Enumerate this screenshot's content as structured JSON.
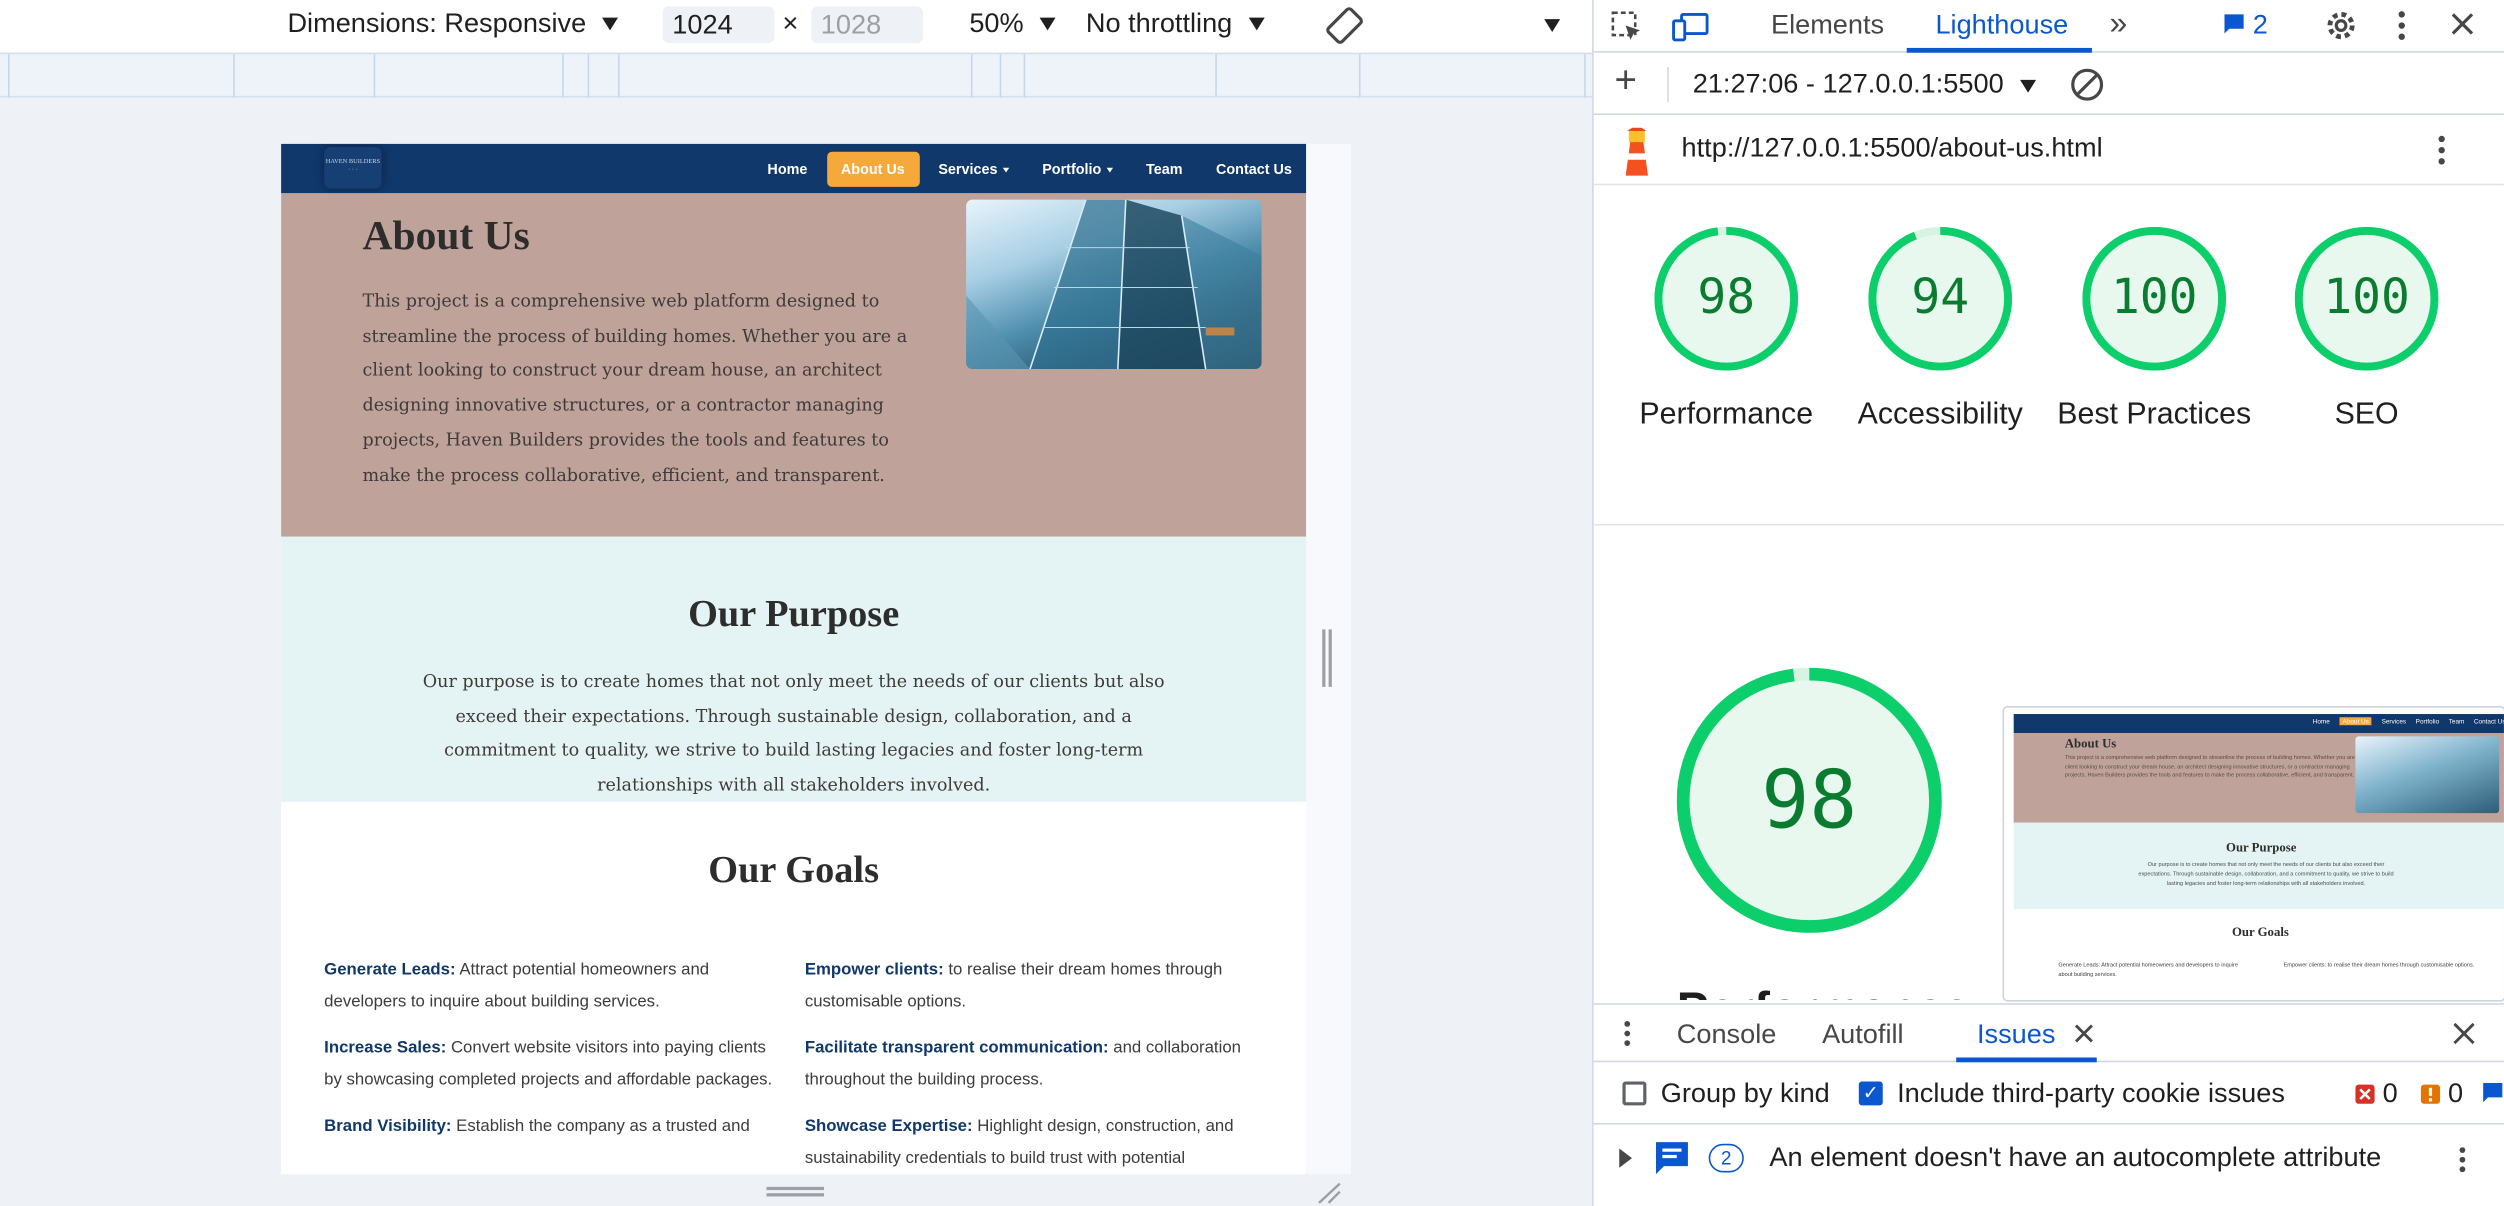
{
  "device_toolbar": {
    "dimensions_label": "Dimensions: Responsive",
    "width_value": "1024",
    "height_placeholder": "1028",
    "times": "×",
    "zoom": "50%",
    "throttling": "No throttling"
  },
  "site": {
    "logo_text": "HAVEN BUILDERS",
    "nav": [
      {
        "label": "Home",
        "dropdown": false,
        "active": false
      },
      {
        "label": "About Us",
        "dropdown": false,
        "active": true
      },
      {
        "label": "Services",
        "dropdown": true,
        "active": false
      },
      {
        "label": "Portfolio",
        "dropdown": true,
        "active": false
      },
      {
        "label": "Team",
        "dropdown": false,
        "active": false
      },
      {
        "label": "Contact Us",
        "dropdown": false,
        "active": false
      }
    ],
    "hero": {
      "title": "About Us",
      "text": "This project is a comprehensive web platform designed to streamline the process of building homes. Whether you are a client looking to construct your dream house, an architect designing innovative structures, or a contractor managing projects, Haven Builders provides the tools and features to make the process collaborative, efficient, and transparent."
    },
    "purpose": {
      "title": "Our Purpose",
      "text": "Our purpose is to create homes that not only meet the needs of our clients but also exceed their expectations. Through sustainable design, collaboration, and a commitment to quality, we strive to build lasting legacies and foster long-term relationships with all stakeholders involved."
    },
    "goals": {
      "title": "Our Goals",
      "left": [
        {
          "term": "Generate Leads:",
          "text": " Attract potential homeowners and developers to inquire about building services."
        },
        {
          "term": "Increase Sales:",
          "text": " Convert website visitors into paying clients by showcasing completed projects and affordable packages."
        },
        {
          "term": "Brand Visibility:",
          "text": " Establish the company as a trusted and"
        }
      ],
      "right": [
        {
          "term": "Empower clients:",
          "text": " to realise their dream homes through customisable options."
        },
        {
          "term": "Facilitate transparent communication:",
          "text": " and collaboration throughout the building process."
        },
        {
          "term": "Showcase Expertise:",
          "text": " Highlight design, construction, and sustainability credentials to build trust with potential"
        }
      ]
    }
  },
  "devtools": {
    "tabs": [
      "Elements",
      "Lighthouse"
    ],
    "active_tab": "Lighthouse",
    "issues_count": "2",
    "report_selector": "21:27:06 - 127.0.0.1:5500",
    "url": "http://127.0.0.1:5500/about-us.html",
    "scores": [
      {
        "label": "Performance",
        "value": 98
      },
      {
        "label": "Accessibility",
        "value": 94
      },
      {
        "label": "Best Practices",
        "value": 100
      },
      {
        "label": "SEO",
        "value": 100
      }
    ],
    "big_score": 98,
    "big_label": "Performance",
    "thumbnail": {
      "nav": [
        "Home",
        "About Us",
        "Services",
        "Portfolio",
        "Team",
        "Contact Us"
      ],
      "about_title": "About Us",
      "about_text": "This project is a comprehensive web platform designed to streamline the process of building homes. Whether you are a client looking to construct your dream house, an architect designing innovative structures, or a contractor managing projects, Haven Builders provides the tools and features to make the process collaborative, efficient, and transparent.",
      "purpose_title": "Our Purpose",
      "purpose_text": "Our purpose is to create homes that not only meet the needs of our clients but also exceed their expectations. Through sustainable design, collaboration, and a commitment to quality, we strive to build lasting legacies and foster long-term relationships with all stakeholders involved.",
      "goals_title": "Our Goals",
      "goal_left": "Generate Leads: Attract potential homeowners and developers to inquire about building services.",
      "goal_right": "Empower clients: to realise their dream homes through customisable options."
    },
    "drawer": {
      "tabs": [
        "Console",
        "Autofill",
        "Issues"
      ],
      "active_tab": "Issues",
      "group_by_kind": "Group by kind",
      "include_third_party": "Include third-party cookie issues",
      "error_count": "0",
      "warning_count": "0",
      "issue_count": "2",
      "issue_text": "An element doesn't have an autocomplete attribute"
    },
    "colors": {
      "accent": "#0b57d0",
      "score_green": "#0cce6b",
      "nav_blue": "#10386a",
      "nav_active": "#f5a93a"
    }
  }
}
